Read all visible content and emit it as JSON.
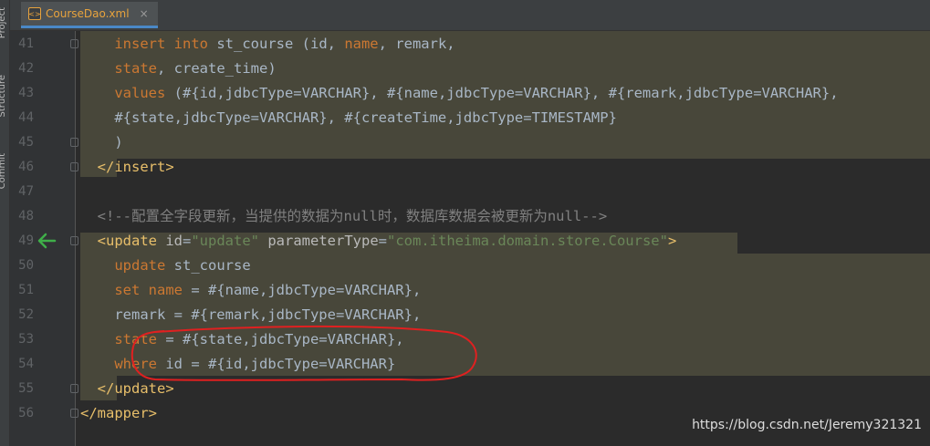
{
  "tab": {
    "icon": "xml-file-icon",
    "label": "CourseDao.xml",
    "close": "×"
  },
  "sidebar": {
    "labels": [
      "Project",
      "Structure",
      "Commit"
    ]
  },
  "editor": {
    "lines": [
      {
        "num": "41"
      },
      {
        "num": "42"
      },
      {
        "num": "43"
      },
      {
        "num": "44"
      },
      {
        "num": "45"
      },
      {
        "num": "46"
      },
      {
        "num": "47"
      },
      {
        "num": "48"
      },
      {
        "num": "49"
      },
      {
        "num": "50"
      },
      {
        "num": "51"
      },
      {
        "num": "52"
      },
      {
        "num": "53"
      },
      {
        "num": "54"
      },
      {
        "num": "55"
      },
      {
        "num": "56"
      }
    ],
    "t": {
      "l41a": "insert",
      "l41b": "into",
      "l41c": " st_course (id, ",
      "l41d": "name",
      "l41e": ", remark,",
      "l42a": "state",
      "l42b": ", create_time)",
      "l43a": "values",
      "l43b": " (#{id,jdbcType=VARCHAR}, #{name,jdbcType=VARCHAR}, #{remark,jdbcType=VARCHAR},",
      "l44a": "#{state,jdbcType=VARCHAR}, #{createTime,jdbcType=TIMESTAMP}",
      "l45a": ")",
      "l46a": "</insert>",
      "l48a": "<!--配置全字段更新，当提供的数据为null时，数据库数据会被更新为null-->",
      "l49a": "<update ",
      "l49b": "id",
      "l49c": "=",
      "l49d": "\"update\"",
      "l49e": " parameterType",
      "l49f": "=",
      "l49g": "\"com.itheima.domain.store.Course\"",
      "l49h": ">",
      "l50a": "update",
      "l50b": " st_course",
      "l51a": "set",
      "l51b": " ",
      "l51c": "name",
      "l51d": " = #{name,jdbcType=VARCHAR},",
      "l52a": "remark = #{remark,jdbcType=VARCHAR},",
      "l53a": "state",
      "l53b": " = #{state,jdbcType=VARCHAR},",
      "l54a": "where",
      "l54b": " id = #{id,jdbcType=VARCHAR}",
      "l55a": "</update>",
      "l56a": "</mapper>"
    }
  },
  "watermark": "https://blog.csdn.net/Jeremy321321",
  "colors": {
    "keyword": "#cc7832",
    "tag": "#e8bf6a",
    "string": "#6a8759",
    "comment": "#808080",
    "highlight": "#48473a",
    "annotation": "#e02020",
    "arrow": "#3fae49"
  }
}
